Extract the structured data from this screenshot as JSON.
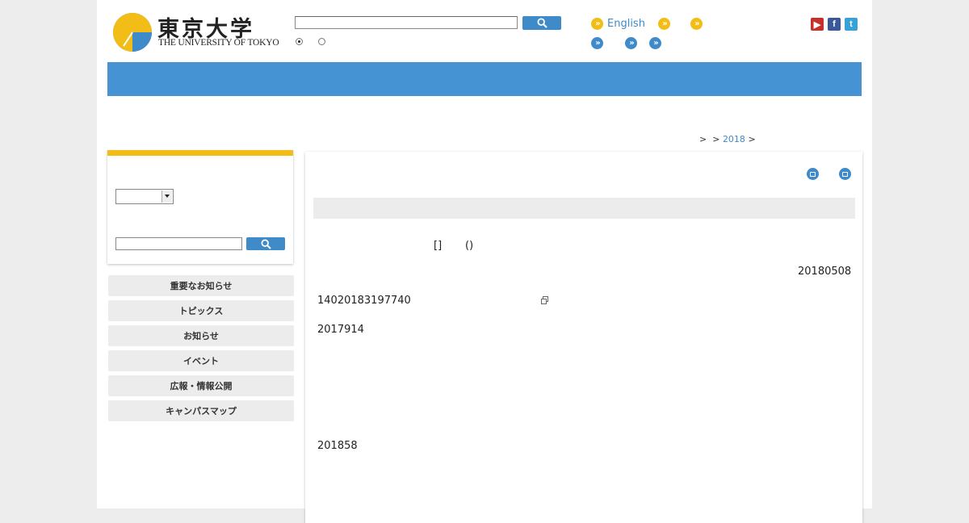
{
  "header": {
    "logo_jp": "東京大学",
    "logo_en": "THE UNIVERSITY OF TOKYO",
    "english_link": "English"
  },
  "breadcrumb": {
    "sep1": ">",
    "sep2": ">",
    "year_link": "2018",
    "sep3": ">"
  },
  "sidebar": {
    "menu": [
      "重要なお知らせ",
      "トピックス",
      "お知らせ",
      "イベント",
      "広報・情報公開",
      "キャンパスマップ"
    ]
  },
  "content": {
    "bracket_text": "[]",
    "paren_text": "()",
    "date": "20180508",
    "line_1": "14020183197740",
    "line_2": "2017914",
    "line_3": "201858"
  },
  "colors": {
    "accent_blue": "#4593d2",
    "accent_yellow": "#f2bd16"
  },
  "icons": [
    "search-icon",
    "chevron-right-icon",
    "youtube-icon",
    "facebook-icon",
    "twitter-icon",
    "print-icon",
    "external-link-icon"
  ]
}
